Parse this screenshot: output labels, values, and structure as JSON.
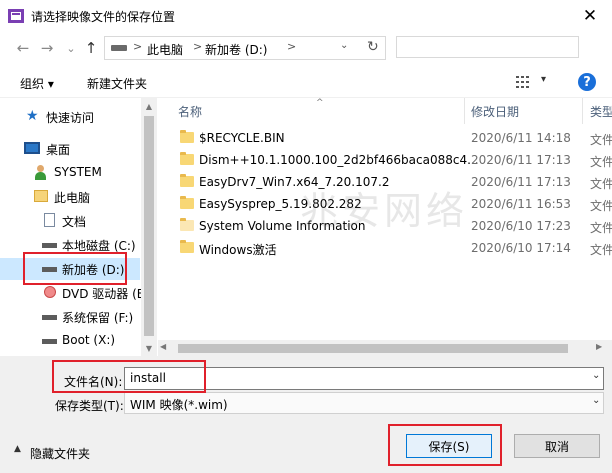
{
  "window": {
    "title": "请选择映像文件的保存位置",
    "close_glyph": "✕"
  },
  "nav": {
    "back_glyph": "←",
    "forward_glyph": "→",
    "recent_glyph": "⌄",
    "up_glyph": "↑",
    "breadcrumbs": [
      "此电脑",
      "新加卷 (D:)"
    ],
    "separator": ">",
    "refresh_glyph": "↻",
    "dropdown_glyph": "⌄",
    "search_placeholder": ""
  },
  "toolbar": {
    "organize_label": "组织 ▾",
    "new_folder_label": "新建文件夹",
    "view_dropdown_glyph": "▾",
    "help_glyph": "?"
  },
  "sidebar": {
    "items": [
      {
        "label": "快速访问",
        "icon": "star-icon"
      },
      {
        "label": "桌面",
        "icon": "desktop-icon"
      },
      {
        "label": "SYSTEM",
        "icon": "user-icon"
      },
      {
        "label": "此电脑",
        "icon": "computer-icon"
      },
      {
        "label": "文档",
        "icon": "document-icon"
      },
      {
        "label": "本地磁盘 (C:)",
        "icon": "drive-icon"
      },
      {
        "label": "新加卷 (D:)",
        "icon": "drive-icon"
      },
      {
        "label": "DVD 驱动器 (E",
        "icon": "dvd-drive-icon"
      },
      {
        "label": "系统保留 (F:)",
        "icon": "drive-icon"
      },
      {
        "label": "Boot (X:)",
        "icon": "drive-icon"
      }
    ],
    "selected_index": 6
  },
  "filelist": {
    "columns": [
      "名称",
      "修改日期",
      "类型"
    ],
    "rows": [
      {
        "name": "$RECYCLE.BIN",
        "date": "2020/6/11 14:18",
        "type": "文件"
      },
      {
        "name": "Dism++10.1.1000.100_2d2bf466baca088c4...",
        "date": "2020/6/11 17:13",
        "type": "文件"
      },
      {
        "name": "EasyDrv7_Win7.x64_7.20.107.2",
        "date": "2020/6/11 17:13",
        "type": "文件"
      },
      {
        "name": "EasySysprep_5.19.802.282",
        "date": "2020/6/11 16:53",
        "type": "文件"
      },
      {
        "name": "System Volume Information",
        "date": "2020/6/10 17:23",
        "type": "文件"
      },
      {
        "name": "Windows激活",
        "date": "2020/6/10 17:14",
        "type": "文件"
      }
    ],
    "watermark": "兆安网络"
  },
  "form": {
    "filename_label": "文件名(N):",
    "filename_value": "install",
    "filetype_label": "保存类型(T):",
    "filetype_value": "WIM 映像(*.wim)",
    "dropdown_glyph": "⌄"
  },
  "footer": {
    "hide_folders_label": "隐藏文件夹",
    "save_label": "保存(S)",
    "cancel_label": "取消"
  },
  "colors": {
    "accent": "#0078d7",
    "highlight_box": "#e0202b",
    "help_icon": "#1a6fd9",
    "folder": "#f8d775"
  }
}
